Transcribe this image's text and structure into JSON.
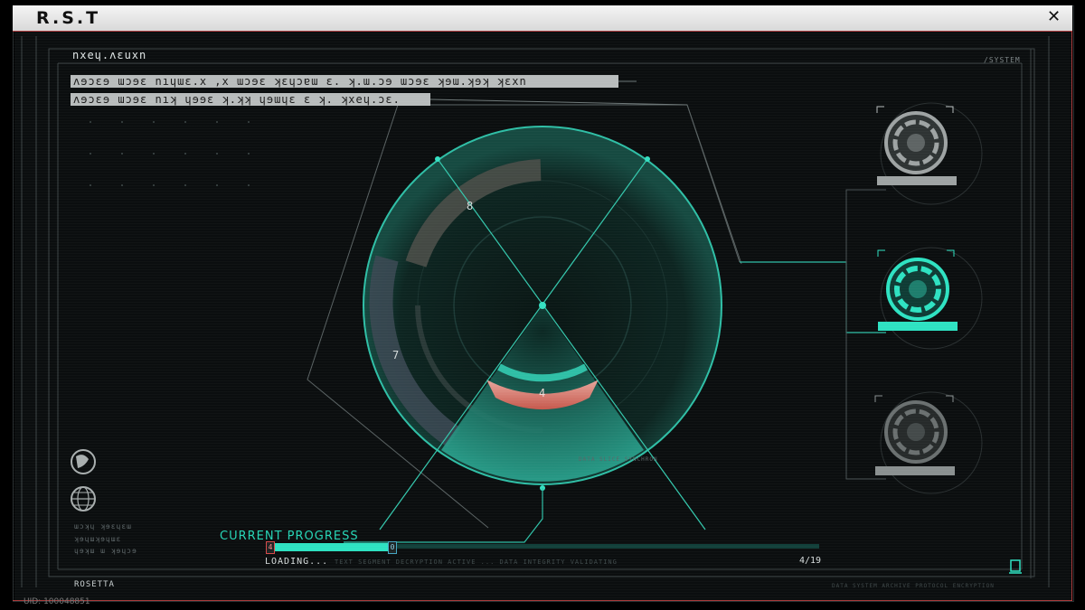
{
  "window": {
    "title": "R.S.T",
    "close_icon": "close-icon"
  },
  "header": {
    "subtitle": "nxeɥ.ʌɛuxn",
    "system_label": "/SYSTEM",
    "banner_line_1": "ʌɘɔɛɘ ɯɔɘɛ nıɥɯɛ.x ,x ɯɔɘɛ ʞɛɥɔɐɯ ɛ. ʞ.ɯ.ɔɘ ɯɔɘɛ ʞɘɯ.ʞɘʞ ʞɛxn",
    "banner_line_2": "ʌɘɔɛɘ ɯɔɘɛ nıʞ ɥɘɘɛ ʞ.ʞʞ ɥɘɯɥɛ ɛ ʞ. ʞxeɥ.ɔɛ."
  },
  "dial": {
    "segment_labels": [
      "8",
      "7",
      "4"
    ],
    "inner_caption": "DATA SLICE SYNCHRON"
  },
  "right_panel": {
    "nodes": [
      {
        "name": "node-top",
        "state": "inactive",
        "icon": "target-disc-icon"
      },
      {
        "name": "node-middle",
        "state": "active",
        "icon": "target-disc-icon"
      },
      {
        "name": "node-bottom",
        "state": "inactive",
        "icon": "target-disc-icon"
      }
    ]
  },
  "left_panel": {
    "icons": [
      "globe-icon",
      "grid-globe-icon"
    ],
    "info_lines": [
      "ɯɔʞɥ ʞɘɛɥɛɯ",
      "ʞɘɥɯʞɘɥɯɛ",
      "ɥɘʞɯ ɯ ʞɘɥɔɘ"
    ]
  },
  "progress": {
    "label": "CURRENT PROGRESS",
    "status": "LOADING...",
    "status_detail": "TEXT SEGMENT DECRYPTION ACTIVE ... DATA INTEGRITY VALIDATING",
    "left_cap": "4",
    "right_cap": "0",
    "fraction": 0.21,
    "count": "4/19"
  },
  "footer": {
    "left_label": "ROSETTA",
    "right_text": "DATA SYSTEM ARCHIVE PROTOCOL ENCRYPTION",
    "bottom_icon": "terminal-icon",
    "uid": "UID: 100048851"
  },
  "colors": {
    "accent": "#2ee2c2",
    "danger": "#e86a5e",
    "frame": "#0b0e0f"
  }
}
